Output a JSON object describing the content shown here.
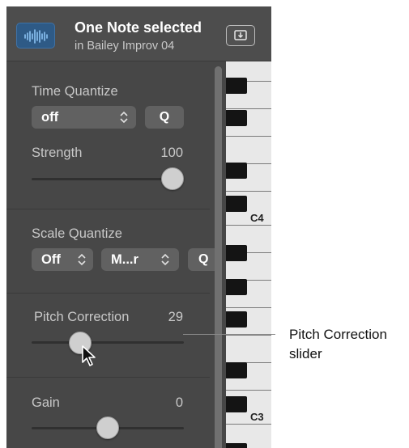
{
  "header": {
    "title": "One Note selected",
    "subtitle": "in Bailey Improv 04"
  },
  "time_quantize": {
    "label": "Time Quantize",
    "value": "off",
    "q_button": "Q",
    "strength_label": "Strength",
    "strength_value": "100",
    "strength_level": 1.0
  },
  "scale_quantize": {
    "label": "Scale Quantize",
    "root_value": "Off",
    "scale_value": "M...r",
    "q_button_partial": "Q"
  },
  "pitch_correction": {
    "label": "Pitch Correction",
    "value": "29",
    "level": 0.29
  },
  "gain": {
    "label": "Gain",
    "value": "0",
    "level": 0.5
  },
  "keyboard": {
    "labels": [
      "C4",
      "C3"
    ]
  },
  "callout": {
    "line1": "Pitch Correction",
    "line2": "slider"
  },
  "colors": {
    "panel": "#474747",
    "header": "#4d4d4d",
    "region_icon": "#2e5a86",
    "waveform": "#8cc4f5",
    "knob": "#cfcfcf"
  }
}
